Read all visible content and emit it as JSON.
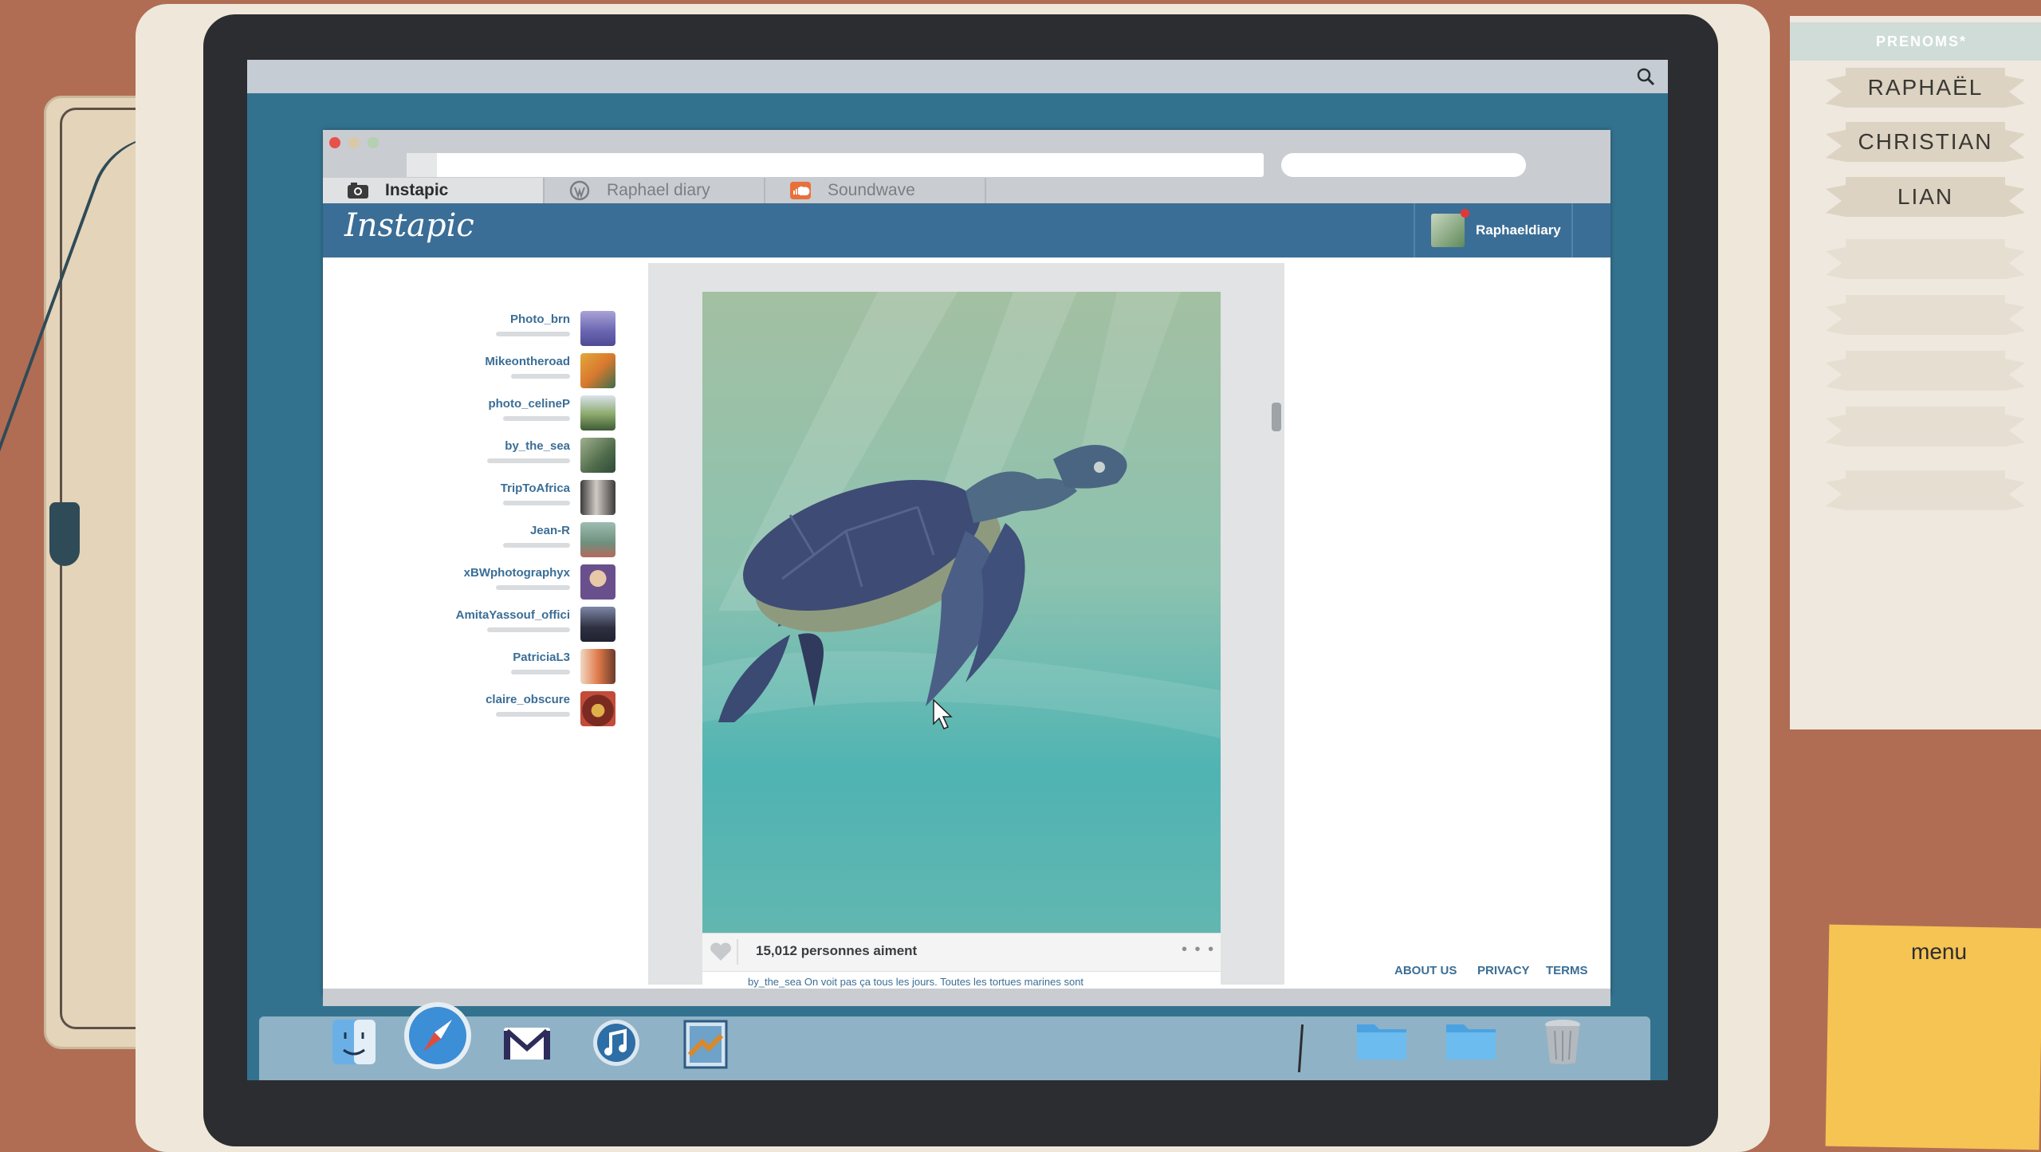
{
  "browser": {
    "tabs": [
      {
        "label": "Instapic",
        "icon": "camera-icon",
        "active": true
      },
      {
        "label": "Raphael diary",
        "icon": "wordpress-icon",
        "active": false
      },
      {
        "label": "Soundwave",
        "icon": "soundcloud-icon",
        "active": false
      }
    ]
  },
  "site": {
    "logo": "Instapic",
    "user": {
      "name": "Raphaeldiary",
      "notification": true
    }
  },
  "following": [
    {
      "name": "Photo_brn"
    },
    {
      "name": "Mikeontheroad"
    },
    {
      "name": "photo_celineP"
    },
    {
      "name": "by_the_sea"
    },
    {
      "name": "TripToAfrica"
    },
    {
      "name": "Jean-R"
    },
    {
      "name": "xBWphotographyx"
    },
    {
      "name": "AmitaYassouf_offici"
    },
    {
      "name": "PatriciaL3"
    },
    {
      "name": "claire_obscure"
    }
  ],
  "post": {
    "image": "sea-turtle-photo",
    "likes": "15,012 personnes aiment",
    "caption": "by_the_sea On voit pas ça tous les jours. Toutes les tortues marines sont",
    "more": "• • •"
  },
  "footer": {
    "about": "ABOUT US",
    "privacy": "PRIVACY",
    "terms": "TERMS"
  },
  "dock": [
    "finder-icon",
    "safari-icon",
    "mail-icon",
    "music-icon",
    "preview-icon",
    "folder-icon",
    "folder-icon",
    "trash-icon"
  ],
  "notes": {
    "header": "PRENOMS*",
    "names": [
      "RAPHAËL",
      "CHRISTIAN",
      "LIAN"
    ]
  },
  "sticky": {
    "label": "menu"
  },
  "colors": {
    "brand_blue": "#3b6e96",
    "desk": "#b06d53",
    "sticky": "#f5c453"
  }
}
